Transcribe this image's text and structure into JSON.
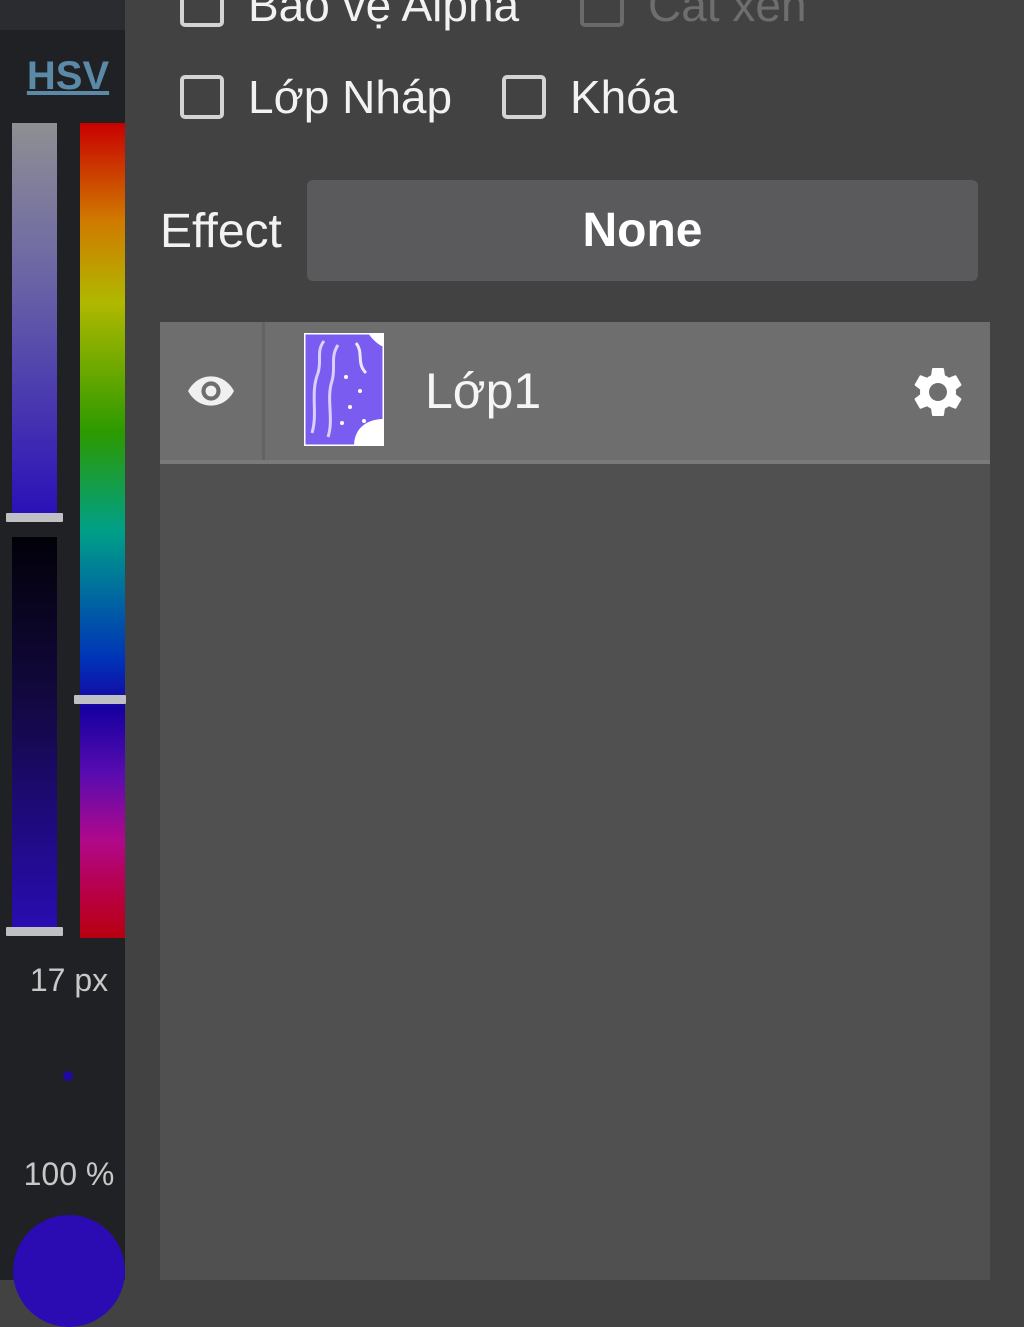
{
  "color_panel": {
    "mode_label": "HSV",
    "brush_size": "17 px",
    "opacity": "100 %",
    "colors": {
      "current": "#2a0cb2",
      "hue_bar_selected": "#5a0cb0"
    }
  },
  "layer_options": {
    "checkboxes": [
      {
        "label": "Bảo vệ Alpha",
        "checked": false,
        "enabled": true
      },
      {
        "label": "Cắt xén",
        "checked": false,
        "enabled": false
      },
      {
        "label": "Lớp Nháp",
        "checked": false,
        "enabled": true
      },
      {
        "label": "Khóa",
        "checked": false,
        "enabled": true
      }
    ],
    "effect_label": "Effect",
    "effect_value": "None"
  },
  "layers": [
    {
      "name": "Lớp1",
      "visible": true,
      "thumbnail_icon": "purple-artwork-thumbnail"
    }
  ],
  "icons": {
    "visibility": "eye-icon",
    "settings": "gear-icon"
  },
  "theme": {
    "background": "#424242",
    "layer_row": "#6e6e6e",
    "list_bg": "#505050",
    "accent_link": "#5b8aa8"
  }
}
